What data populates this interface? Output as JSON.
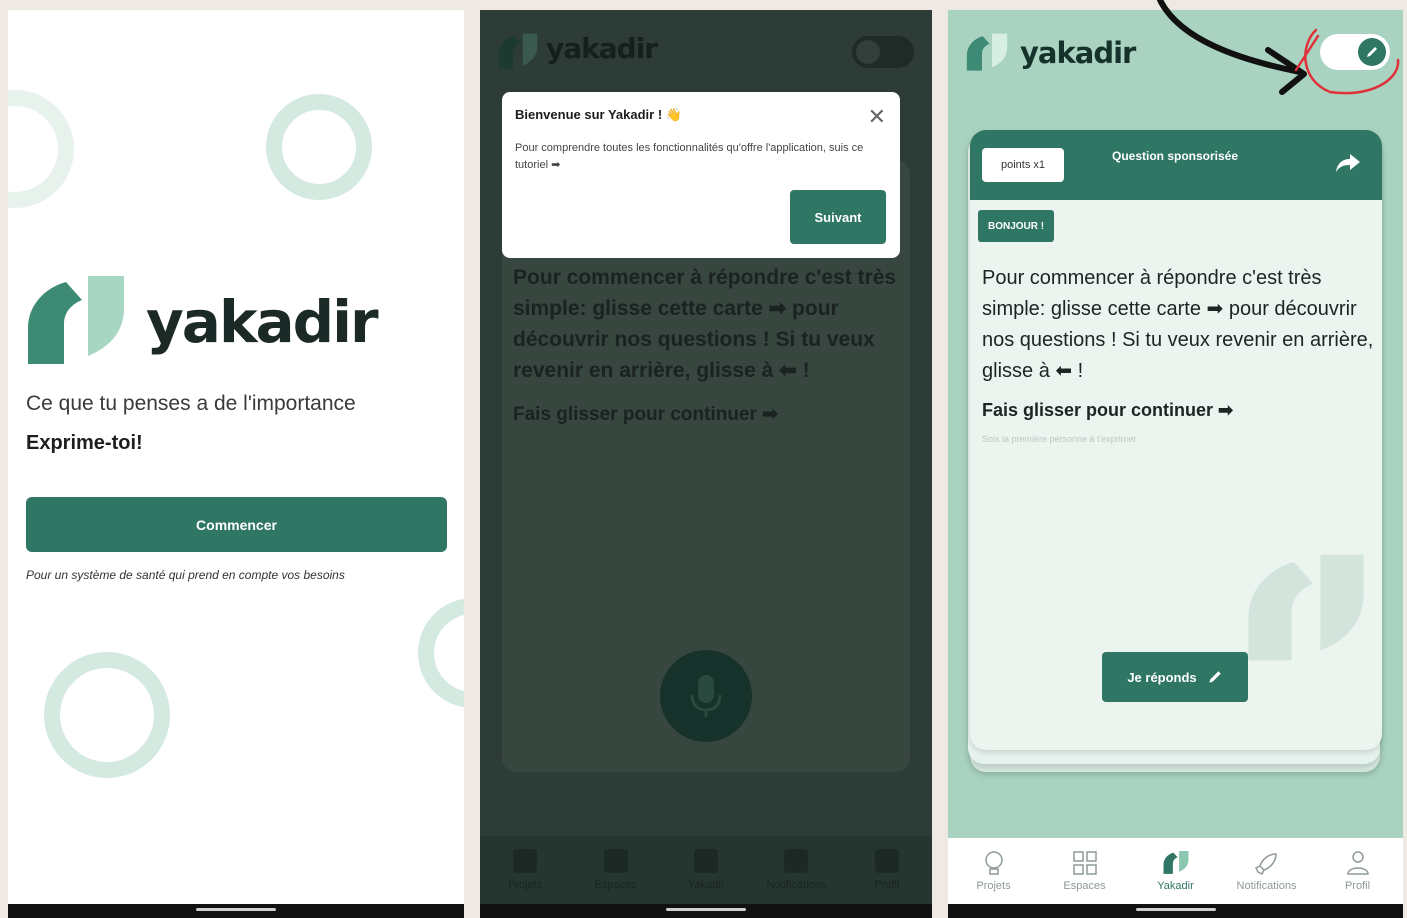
{
  "brand": {
    "name": "yakadir"
  },
  "screen1": {
    "tagline": "Ce que tu penses a de l'importance",
    "express": "Exprime-toi!",
    "start_button": "Commencer",
    "note": "Pour un système de santé qui prend en compte vos besoins"
  },
  "screen2": {
    "tooltip": {
      "title": "Bienvenue sur Yakadir ! 👋",
      "body": "Pour comprendre toutes les fonctionnalités qu'offre l'application, suis ce tutoriel ➡",
      "next_button": "Suivant",
      "close": "✕"
    },
    "card_text": "Pour commencer à répondre c'est très simple: glisse cette carte ➡ pour découvrir nos questions ! Si tu veux revenir en arrière, glisse à ⬅ !",
    "card_cta": "Fais glisser pour continuer ➡",
    "nav": [
      "Projets",
      "Espaces",
      "Yakadir",
      "Notifications",
      "Profil"
    ]
  },
  "screen3": {
    "points": "points x1",
    "sponsored": "Question sponsorisée",
    "badge": "BONJOUR !",
    "card_text": "Pour commencer à répondre c'est très simple: glisse cette carte ➡ pour découvrir nos questions ! Si tu veux revenir en arrière, glisse à ⬅ !",
    "card_cta": "Fais glisser pour continuer ➡",
    "faint_hint": "Sois la première personne à t'exprimer",
    "answer_button": "Je réponds",
    "nav": [
      "Projets",
      "Espaces",
      "Yakadir",
      "Notifications",
      "Profil"
    ]
  },
  "colors": {
    "primary": "#2f7665",
    "mint": "#a9d3c0",
    "dark": "#2d3c36",
    "annotation_red": "#e0303a"
  }
}
